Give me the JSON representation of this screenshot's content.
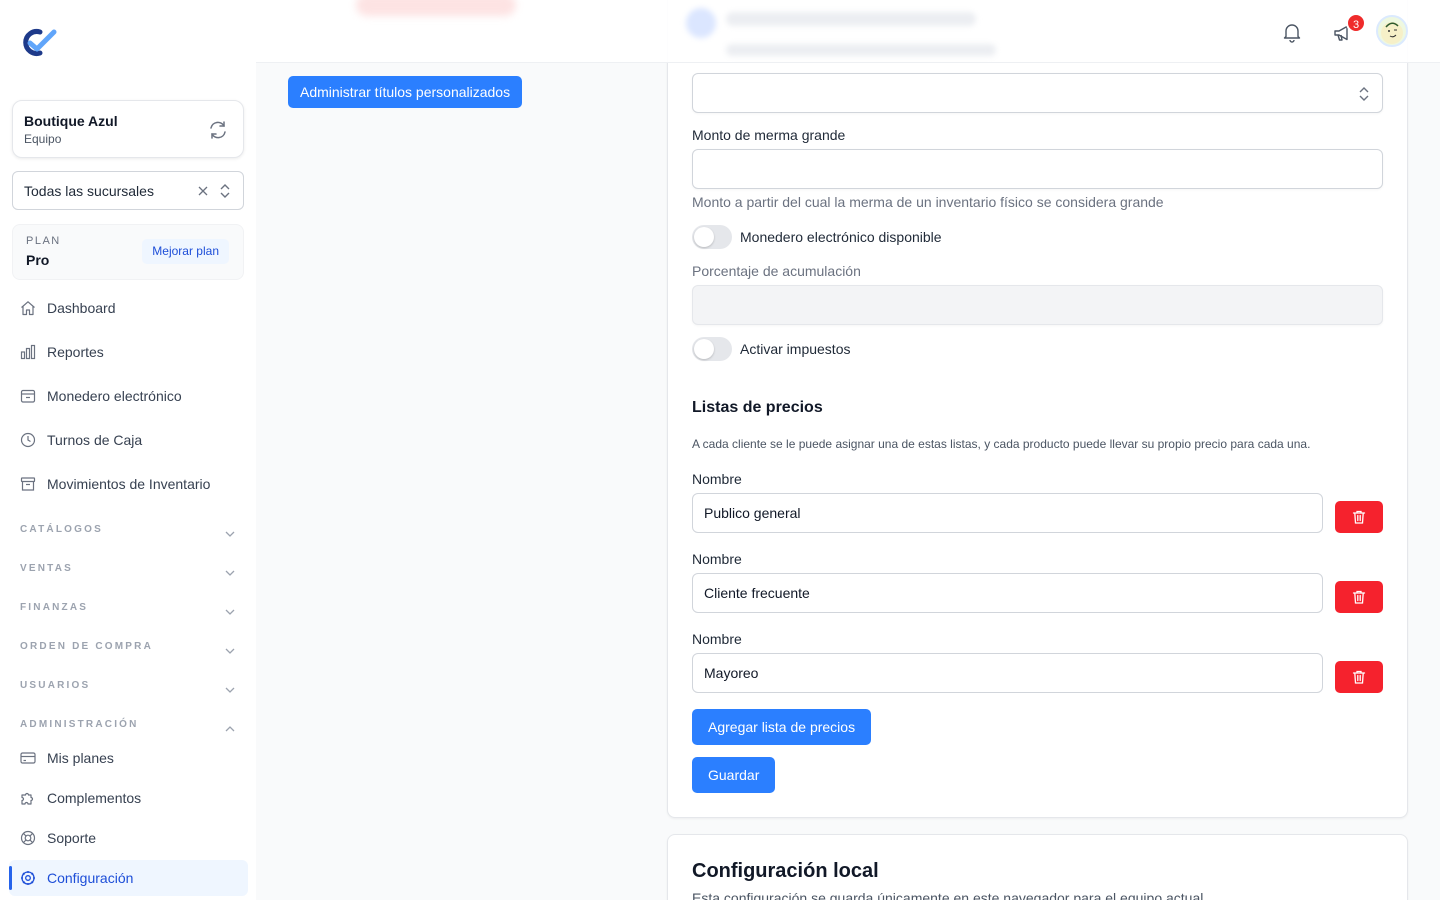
{
  "sidebar": {
    "team": {
      "name": "Boutique Azul",
      "subtitle": "Equipo"
    },
    "branch_select": {
      "value": "Todas las sucursales"
    },
    "plan": {
      "label": "PLAN",
      "value": "Pro",
      "upgrade": "Mejorar plan"
    },
    "nav": [
      {
        "label": "Dashboard",
        "icon": "home-icon"
      },
      {
        "label": "Reportes",
        "icon": "bar-chart-icon"
      },
      {
        "label": "Monedero electrónico",
        "icon": "wallet-icon"
      },
      {
        "label": "Turnos de Caja",
        "icon": "clock-icon"
      },
      {
        "label": "Movimientos de Inventario",
        "icon": "archive-icon"
      }
    ],
    "sections": [
      "CATÁLOGOS",
      "VENTAS",
      "FINANZAS",
      "ORDEN DE COMPRA",
      "USUARIOS",
      "ADMINISTRACIÓN"
    ],
    "admin_items": [
      {
        "label": "Mis planes",
        "icon": "credit-card-icon"
      },
      {
        "label": "Complementos",
        "icon": "puzzle-icon"
      },
      {
        "label": "Soporte",
        "icon": "lifebuoy-icon"
      },
      {
        "label": "Configuración",
        "icon": "gear-icon",
        "active": true
      }
    ]
  },
  "topbar": {
    "notifications_count": "3"
  },
  "main": {
    "custom_titles_button": "Administrar títulos personalizados",
    "form": {
      "select_value": "",
      "merma_label": "Monto de merma grande",
      "merma_value": "",
      "merma_help": "Monto a partir del cual la merma de un inventario físico se considera grande",
      "wallet_toggle_label": "Monedero electrónico disponible",
      "wallet_toggle_on": false,
      "accumulation_label": "Porcentaje de acumulación",
      "accumulation_value": "",
      "taxes_toggle_label": "Activar impuestos",
      "taxes_toggle_on": false
    },
    "price_lists": {
      "title": "Listas de precios",
      "description": "A cada cliente se le puede asignar una de estas listas, y cada producto puede llevar su propio precio para cada una.",
      "items": [
        {
          "label": "Nombre",
          "value": "Publico general"
        },
        {
          "label": "Nombre",
          "value": "Cliente frecuente"
        },
        {
          "label": "Nombre",
          "value": "Mayoreo"
        }
      ],
      "add_button": "Agregar lista de precios",
      "save_button": "Guardar"
    },
    "local_config": {
      "title": "Configuración local",
      "description": "Esta configuración se guarda únicamente en este navegador para el equipo actual."
    }
  },
  "colors": {
    "primary": "#2b7fff",
    "danger": "#f5222d",
    "active_nav": "#1d4ed8"
  }
}
